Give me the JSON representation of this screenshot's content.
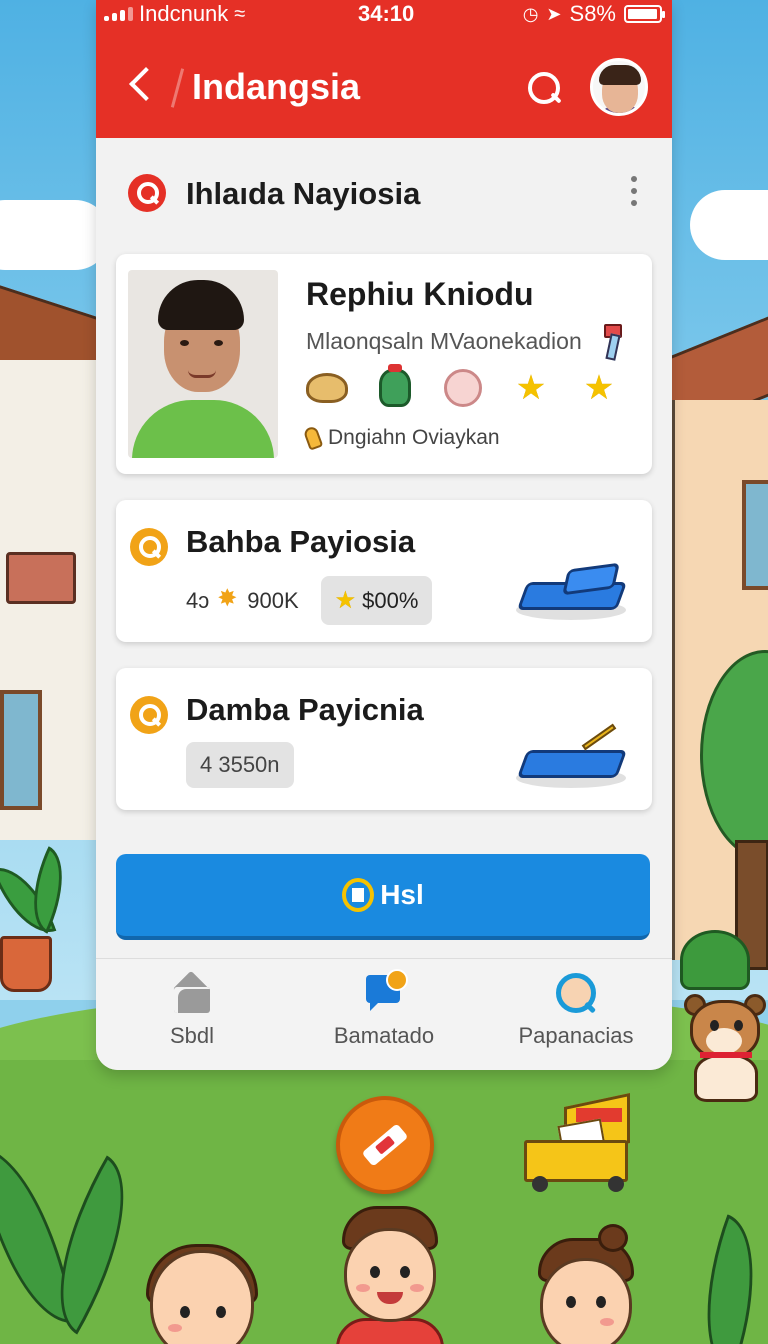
{
  "status_bar": {
    "carrier": "Indcnunk",
    "time": "34:10",
    "battery": "S8%",
    "battery_level": 0.95
  },
  "app_bar": {
    "title": "Indangsia",
    "back_icon": "chevron-left-icon",
    "search_icon": "search-icon",
    "avatar_icon": "avatar"
  },
  "section": {
    "title": "Ihlaıda Nayiosia",
    "menu_icon": "kebab-menu-icon"
  },
  "profile": {
    "name": "Rephiu Kniodu",
    "subtitle": "Mlaonqsaln MVaonekadion",
    "location": "Dngiahn Oviaykan",
    "badges": [
      "bread-icon",
      "pot-icon",
      "ball-icon",
      "star-icon",
      "star-icon"
    ]
  },
  "items": [
    {
      "title": "Bahba Payiosia",
      "count": "4ↄ",
      "amount": "900K",
      "chip": "$00%",
      "icon": "tray-icon"
    },
    {
      "title": "Damba Payicnia",
      "chip": "4 3550n",
      "icon": "tray-pen-icon"
    }
  ],
  "primary_button": {
    "label": "Hsl"
  },
  "bottom_nav": [
    {
      "label": "Sbdl",
      "icon": "home-icon"
    },
    {
      "label": "Bamatado",
      "icon": "chat-icon"
    },
    {
      "label": "Papanacias",
      "icon": "search-icon"
    }
  ],
  "colors": {
    "header_red": "#e53026",
    "button_blue": "#1a8ae0",
    "accent_orange": "#f1a317",
    "star_yellow": "#f5c200"
  }
}
